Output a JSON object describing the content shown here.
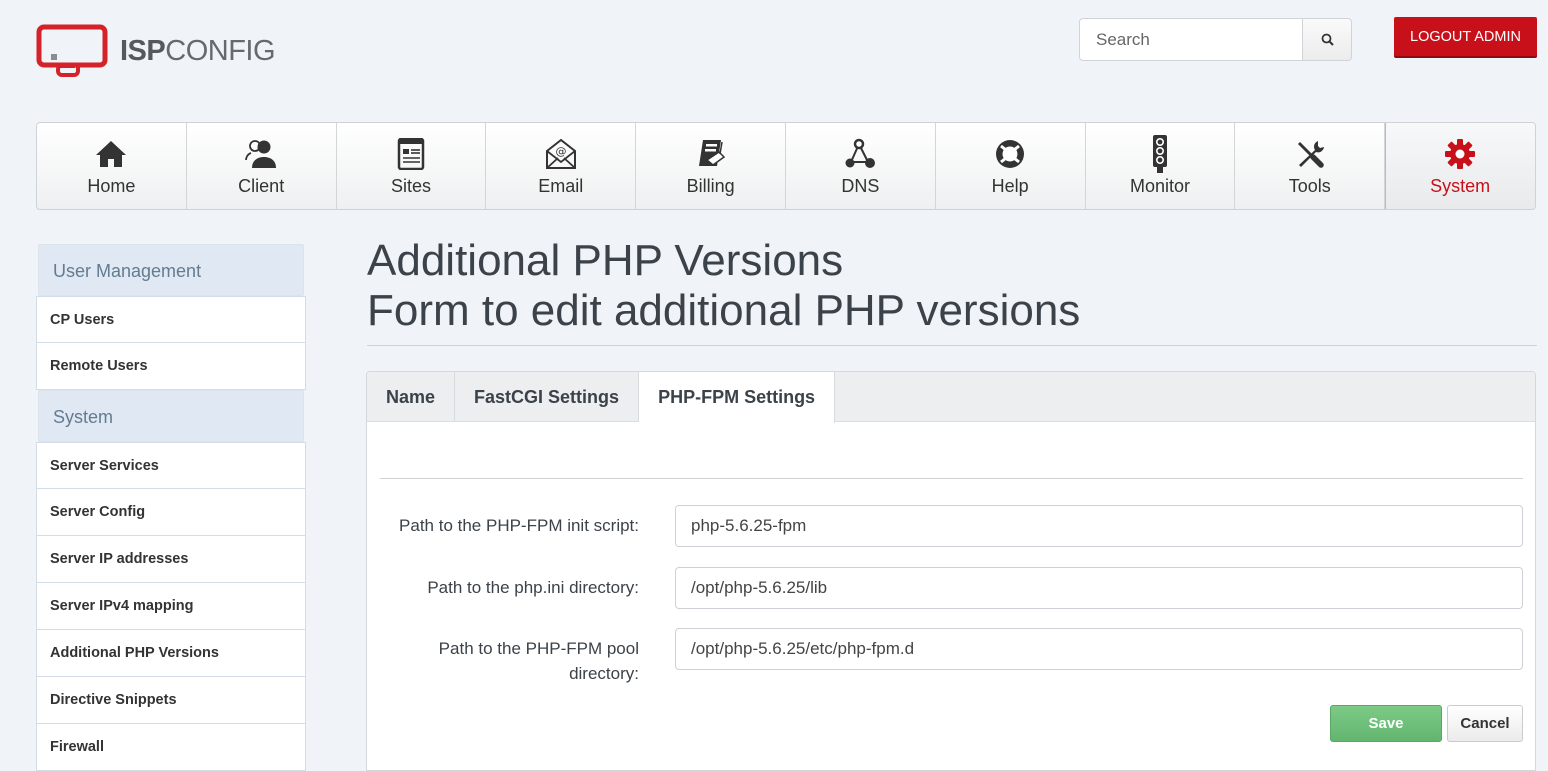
{
  "brand": {
    "logo_bold": "ISP",
    "logo_thin": "CONFIG",
    "accent_color": "#c8101a"
  },
  "header": {
    "search_placeholder": "Search",
    "search_icon": "search-icon",
    "logout_label": "LOGOUT ADMIN"
  },
  "topnav": {
    "items": [
      {
        "label": "Home",
        "icon": "home-icon"
      },
      {
        "label": "Client",
        "icon": "client-icon"
      },
      {
        "label": "Sites",
        "icon": "sites-icon"
      },
      {
        "label": "Email",
        "icon": "email-icon"
      },
      {
        "label": "Billing",
        "icon": "billing-icon"
      },
      {
        "label": "DNS",
        "icon": "dns-icon"
      },
      {
        "label": "Help",
        "icon": "help-icon"
      },
      {
        "label": "Monitor",
        "icon": "monitor-icon"
      },
      {
        "label": "Tools",
        "icon": "tools-icon"
      },
      {
        "label": "System",
        "icon": "gear-icon",
        "active": true
      }
    ]
  },
  "sidebar": {
    "sections": [
      {
        "heading": "User Management",
        "items": [
          "CP Users",
          "Remote Users"
        ]
      },
      {
        "heading": "System",
        "items": [
          "Server Services",
          "Server Config",
          "Server IP addresses",
          "Server IPv4 mapping",
          "Additional PHP Versions",
          "Directive Snippets",
          "Firewall"
        ]
      }
    ]
  },
  "main": {
    "title_line1": "Additional PHP Versions",
    "title_line2": "Form to edit additional PHP versions",
    "tabs": [
      {
        "label": "Name"
      },
      {
        "label": "FastCGI Settings"
      },
      {
        "label": "PHP-FPM Settings",
        "active": true
      }
    ],
    "fields": [
      {
        "label": "Path to the PHP-FPM init script:",
        "value": "php-5.6.25-fpm"
      },
      {
        "label": "Path to the php.ini directory:",
        "value": "/opt/php-5.6.25/lib"
      },
      {
        "label_line1": "Path to the PHP-FPM pool",
        "label_line2": "directory:",
        "value": "/opt/php-5.6.25/etc/php-fpm.d"
      }
    ],
    "save_label": "Save",
    "cancel_label": "Cancel"
  }
}
